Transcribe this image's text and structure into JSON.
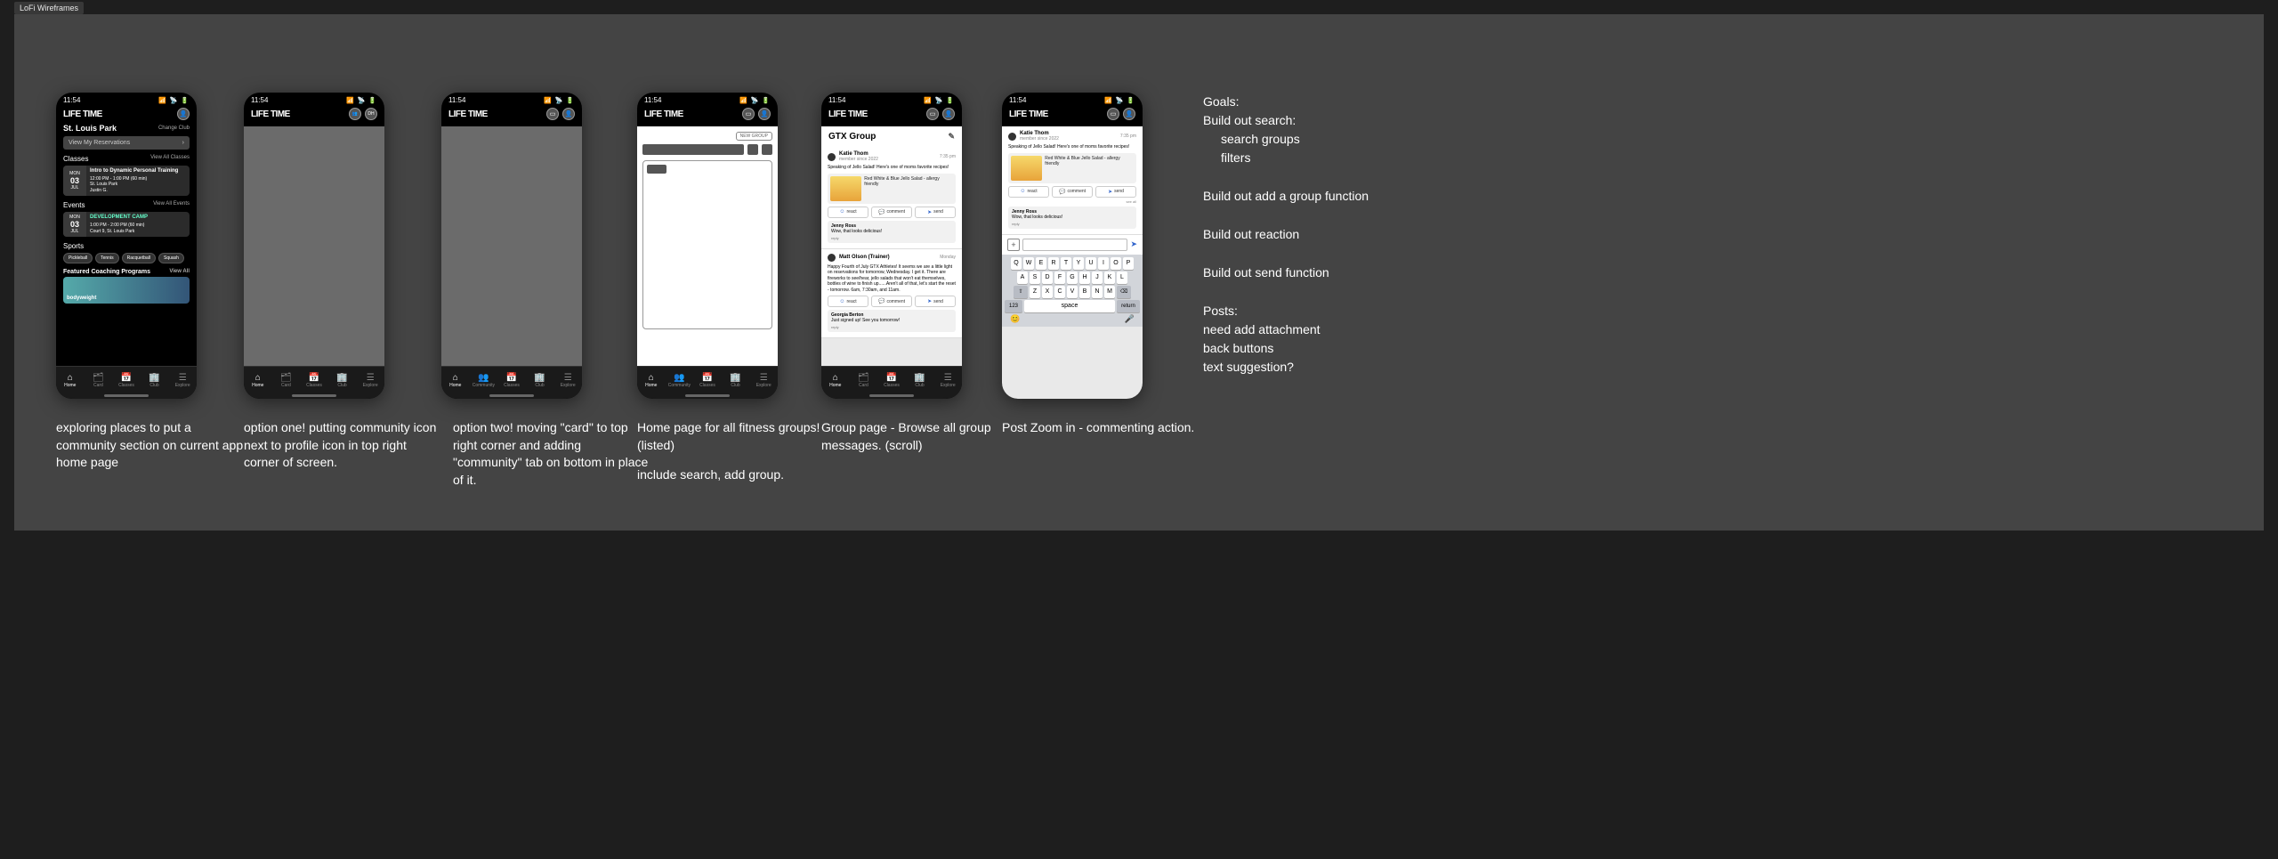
{
  "doc_badge": "LoFi Wireframes",
  "status": {
    "time": "11:54",
    "icons": "📶 📡 🔋"
  },
  "logo": "LIFE TIME",
  "profile": {
    "initials": "DH"
  },
  "tabbar": {
    "items": [
      {
        "icon": "⌂",
        "label": "Home"
      },
      {
        "icon": "🗂",
        "label": "Card"
      },
      {
        "icon": "📅",
        "label": "Classes"
      },
      {
        "icon": "🏢",
        "label": "Club"
      },
      {
        "icon": "☰",
        "label": "Explore"
      }
    ],
    "items6": [
      {
        "icon": "⌂",
        "label": "Home"
      },
      {
        "icon": "👥",
        "label": "Community"
      },
      {
        "icon": "📅",
        "label": "Classes"
      },
      {
        "icon": "🏢",
        "label": "Club"
      },
      {
        "icon": "☰",
        "label": "Explore"
      }
    ]
  },
  "s1": {
    "club": "St. Louis Park",
    "change": "Change Club",
    "reservations": "View My Reservations",
    "sec": {
      "classes": {
        "h": "Classes",
        "m": "View All Classes"
      },
      "events": {
        "h": "Events",
        "m": "View All Events"
      },
      "sports": {
        "h": "Sports"
      },
      "featured": {
        "h": "Featured Coaching Programs",
        "m": "View All"
      }
    },
    "class": {
      "dow": "MON",
      "day": "03",
      "mon": "JUL",
      "title": "Intro to Dynamic Personal Training",
      "time": "12:00 PM - 1:00 PM (60 min)",
      "loc": "St. Louis Park",
      "who": "Justin G."
    },
    "event": {
      "dow": "MON",
      "day": "03",
      "mon": "JUL",
      "title": "DEVELOPMENT CAMP",
      "time": "1:00 PM - 2:00 PM (60 min)",
      "loc": "Court 9, St. Louis Park"
    },
    "chips": [
      "Pickleball",
      "Tennis",
      "Racquetball",
      "Squash"
    ],
    "feat_label": "bodyweight"
  },
  "s4": {
    "new_group": "NEW GROUP"
  },
  "feed": {
    "group": "GTX Group",
    "p1": {
      "name": "Katie Thom",
      "sub": "member since 2022",
      "time": "7:35 pm",
      "text": "Speaking of Jello Salad! Here's one of moms favorite recipes!",
      "link": {
        "title": "Red White & Blue Jello Salad - allergy friendly"
      },
      "react": "react",
      "comment": "comment",
      "send": "send"
    },
    "c1": {
      "name": "Jenny Ross",
      "text": "Wow, that looks delicious!",
      "reply": "reply"
    },
    "p2": {
      "name": "Matt Olson (Trainer)",
      "time": "Monday",
      "text": "Happy Fourth of July GTX Athletes! It seems we are a little light on reservations for tomorrow, Wednesday. I get it. There are fireworks to see/hear, jello salads that won't eat themselves, bottles of wine to finish up......Aren't all of that, let's start the reset - tomorrow. 6am, 7:30am, and 11am."
    },
    "p3": {
      "name": "Georgia Berton",
      "text": "Just signed up! See you tomorrow!"
    }
  },
  "kbd": {
    "r1": [
      "Q",
      "W",
      "E",
      "R",
      "T",
      "Y",
      "U",
      "I",
      "O",
      "P"
    ],
    "r2": [
      "A",
      "S",
      "D",
      "F",
      "G",
      "H",
      "J",
      "K",
      "L"
    ],
    "r3": [
      "Z",
      "X",
      "C",
      "V",
      "B",
      "N",
      "M"
    ],
    "shift": "⇧",
    "del": "⌫",
    "num": "123",
    "space": "space",
    "ret": "return",
    "emoji": "😊",
    "mic": "🎤"
  },
  "captions": {
    "c1": "exploring places to put a community section on current app home page",
    "c2": "option one! putting community icon next to profile icon in top right corner of screen.",
    "c3": "option two! moving \"card\" to top right corner and adding \"community\" tab on bottom in place of it.",
    "c4a": "Home page for all fitness groups! (listed)",
    "c4b": "include search, add group.",
    "c5": "Group page - Browse all group messages. (scroll)",
    "c6": "Post Zoom in - commenting action."
  },
  "notes": {
    "goals": "Goals:",
    "g1": "Build out search:",
    "g1a": "search groups",
    "g1b": "filters",
    "g2": "Build out add a group function",
    "g3": "Build out reaction",
    "g4": "Build out send function",
    "posts": "Posts:",
    "p1": "need add attachment",
    "p2": "back buttons",
    "p3": "text suggestion?"
  }
}
